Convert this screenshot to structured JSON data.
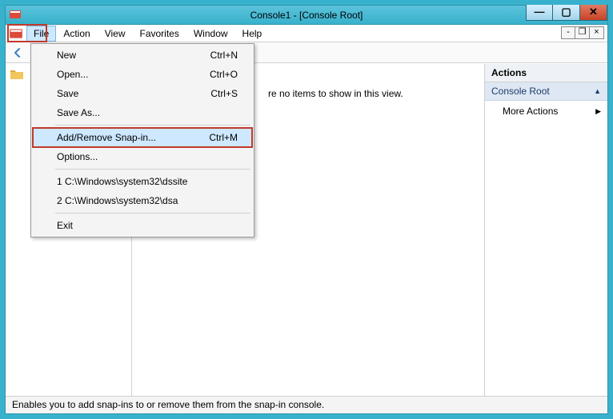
{
  "window": {
    "title": "Console1 - [Console Root]"
  },
  "menubar": {
    "items": [
      "File",
      "Action",
      "View",
      "Favorites",
      "Window",
      "Help"
    ],
    "open_index": 0
  },
  "dropdown": {
    "new": {
      "label": "New",
      "shortcut": "Ctrl+N"
    },
    "open": {
      "label": "Open...",
      "shortcut": "Ctrl+O"
    },
    "save": {
      "label": "Save",
      "shortcut": "Ctrl+S"
    },
    "saveas": {
      "label": "Save As..."
    },
    "addremove": {
      "label": "Add/Remove Snap-in...",
      "shortcut": "Ctrl+M"
    },
    "options": {
      "label": "Options..."
    },
    "recent1": {
      "label": "1 C:\\Windows\\system32\\dssite"
    },
    "recent2": {
      "label": "2 C:\\Windows\\system32\\dsa"
    },
    "exit": {
      "label": "Exit"
    }
  },
  "content": {
    "empty_msg": "re no items to show in this view."
  },
  "actions": {
    "header": "Actions",
    "root_label": "Console Root",
    "more_label": "More Actions"
  },
  "status": {
    "text": "Enables you to add snap-ins to or remove them from the snap-in console."
  }
}
